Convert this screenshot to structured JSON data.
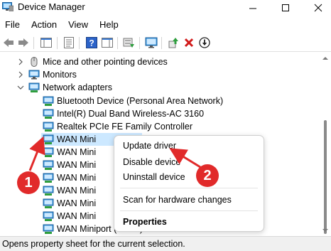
{
  "window": {
    "title": "Device Manager"
  },
  "menu": [
    "File",
    "Action",
    "View",
    "Help"
  ],
  "tree": {
    "categories": [
      {
        "label": "Mice and other pointing devices",
        "expanded": false
      },
      {
        "label": "Monitors",
        "expanded": false
      },
      {
        "label": "Network adapters",
        "expanded": true
      }
    ],
    "network_adapters": [
      "Bluetooth Device (Personal Area Network)",
      "Intel(R) Dual Band Wireless-AC 3160",
      "Realtek PCIe FE Family Controller",
      "WAN Mini",
      "WAN Mini",
      "WAN Mini",
      "WAN Mini",
      "WAN Mini",
      "WAN Mini",
      "WAN Mini",
      "WAN Miniport (SSTP)"
    ]
  },
  "context_menu": {
    "items": [
      "Update driver",
      "Disable device",
      "Uninstall device",
      "Scan for hardware changes",
      "Properties"
    ]
  },
  "annotations": {
    "badge1": "1",
    "badge2": "2",
    "color": "#e12a2a"
  },
  "status": {
    "text": "Opens property sheet for the current selection."
  }
}
